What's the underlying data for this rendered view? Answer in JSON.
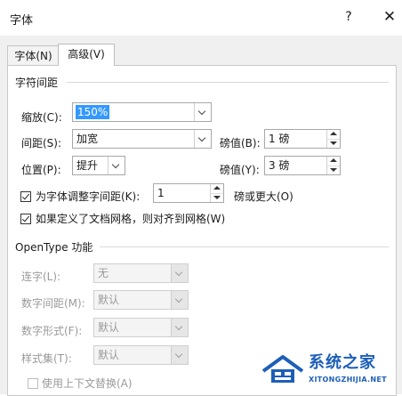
{
  "window": {
    "title": "字体",
    "help_glyph": "?",
    "close_glyph": "✕"
  },
  "tabs": [
    {
      "label": "字体(N)",
      "active": false
    },
    {
      "label": "高级(V)",
      "active": true
    }
  ],
  "char_spacing": {
    "section_title": "字符间距",
    "scale": {
      "label": "缩放(C):",
      "value": "150%"
    },
    "spacing": {
      "label": "间距(S):",
      "value": "加宽",
      "by_label": "磅值(B):",
      "by_value": "1 磅"
    },
    "position": {
      "label": "位置(P):",
      "value": "提升",
      "by_label": "磅值(Y):",
      "by_value": "3 磅"
    },
    "kerning": {
      "label": "为字体调整字间距(K):",
      "value": "1",
      "suffix": "磅或更大(O)",
      "checked": true
    },
    "snap_grid": {
      "label": "如果定义了文档网格，则对齐到网格(W)",
      "checked": true
    }
  },
  "opentype": {
    "section_title": "OpenType 功能",
    "ligatures": {
      "label": "连字(L):",
      "value": "无"
    },
    "number_spacing": {
      "label": "数字间距(M):",
      "value": "默认"
    },
    "number_forms": {
      "label": "数字形式(F):",
      "value": "默认"
    },
    "stylistic_sets": {
      "label": "样式集(T):",
      "value": "默认"
    },
    "contextual_alternates": {
      "label": "使用上下文替换(A)",
      "checked": false
    }
  },
  "watermark": {
    "name": "系统之家",
    "url": "XITONGZHIJIA.NET"
  },
  "colors": {
    "selection": "#3399ff",
    "watermark": "#1d5fb8",
    "dialog_bg": "#f0f0f0"
  }
}
